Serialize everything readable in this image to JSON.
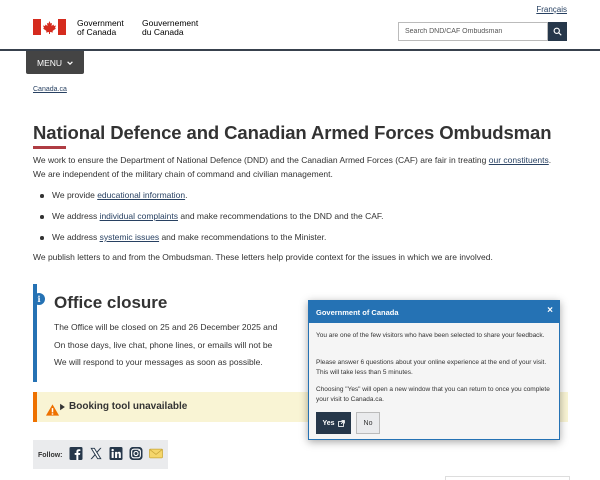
{
  "header": {
    "language_link": "Français",
    "wordmark_en": [
      "Government",
      "of Canada"
    ],
    "wordmark_fr": [
      "Gouvernement",
      "du Canada"
    ],
    "search_placeholder": "Search DND/CAF Ombudsman",
    "menu_label": "MENU"
  },
  "breadcrumb": "Canada.ca",
  "main": {
    "title": "National Defence and Canadian Armed Forces Ombudsman",
    "intro_before": "We work to ensure the Department of National Defence (DND) and the Canadian Armed Forces (CAF) are fair in treating ",
    "intro_link": "our constituents",
    "intro_after": ". We are independent of the military chain of command and civilian management.",
    "bullets": [
      {
        "before": "We provide ",
        "link": "educational information",
        "after": "."
      },
      {
        "before": "We address ",
        "link": "individual complaints",
        "after": " and make recommendations to the DND and the CAF."
      },
      {
        "before": "We address ",
        "link": "systemic issues",
        "after": " and make recommendations to the Minister."
      }
    ],
    "publish": "We publish letters to and from the Ombudsman. These letters help provide context for the issues in which we are involved."
  },
  "closure": {
    "title": "Office closure",
    "line1": "The Office will be closed on 25 and 26 December 2025 and",
    "line2": "On those days, live chat, phone lines, or emails will not be",
    "line3": "We will respond to your messages as soon as possible."
  },
  "booking": {
    "title": "Booking tool unavailable"
  },
  "follow": {
    "label": "Follow:",
    "icons": [
      "facebook-icon",
      "x-icon",
      "linkedin-icon",
      "instagram-icon",
      "email-icon"
    ]
  },
  "popup": {
    "title": "Government of Canada",
    "close": "×",
    "p1": "You are one of the few visitors who have been selected to share your feedback.",
    "p2": "Please answer 6 questions about your online experience at the end of your visit. This will take less than 5 minutes.",
    "p3": "Choosing \"Yes\" will open a new window that you can return to once you complete your visit to Canada.ca.",
    "yes": "Yes",
    "no": "No"
  },
  "colors": {
    "link": "#284162",
    "brand_dark": "#26374a",
    "accent_red": "#af3c43",
    "info_blue": "#2572b4",
    "warning_orange": "#ee7100"
  }
}
